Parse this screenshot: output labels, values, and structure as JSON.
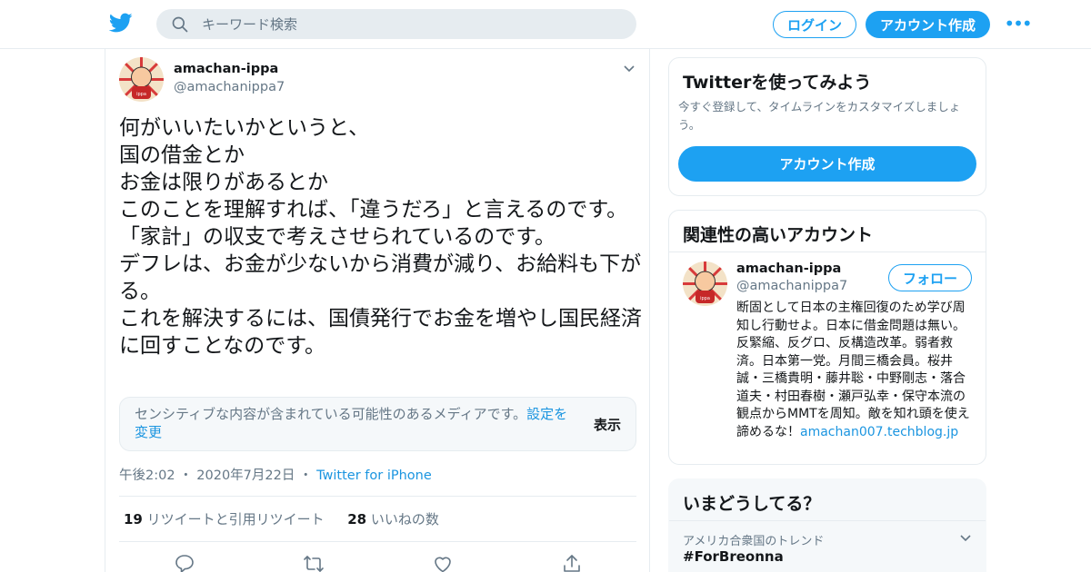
{
  "header": {
    "search_placeholder": "キーワード検索",
    "login_label": "ログイン",
    "signup_label": "アカウント作成",
    "more_label": "•••"
  },
  "tweet": {
    "author_name": "amachan-ippa",
    "author_handle": "@amachanippa7",
    "text": "何がいいたいかというと、\n国の借金とか\nお金は限りがあるとか\nこのことを理解すれば、「違うだろ」と言えるのです。\n「家計」の収支で考えさせられているのです。\nデフレは、お金が少ないから消費が減り、お給料も下がる。\nこれを解決するには、国債発行でお金を増やし国民経済に回すことなのです。",
    "sensitive_notice": "センシティブな内容が含まれている可能性のあるメディアです。",
    "sensitive_settings_link": "設定を変更",
    "sensitive_show": "表示",
    "time": "午後2:02",
    "date": "2020年7月22日",
    "source": "Twitter for iPhone",
    "retweet_count": "19",
    "retweet_label": "リツイートと引用リツイート",
    "like_count": "28",
    "like_label": "いいねの数"
  },
  "sidebar": {
    "try_card": {
      "title": "Twitterを使ってみよう",
      "description": "今すぐ登録して、タイムラインをカスタマイズしましょう。",
      "signup_label": "アカウント作成"
    },
    "related": {
      "title": "関連性の高いアカウント",
      "account_name": "amachan-ippa",
      "account_handle": "@amachanippa7",
      "follow_label": "フォロー",
      "bio": "断固として日本の主権回復のため学び周知し行動せよ。日本に借金問題は無い。反緊縮、反グロ、反構造改革。弱者救済。日本第一党。月間三橋会員。桜井誠・三橋貴明・藤井聡・中野剛志・落合道夫・村田春樹・瀬戸弘幸・保守本流の観点からMMTを周知。敵を知れ頭を使え諦めるな！",
      "bio_link": "amachan007.techblog.jp"
    },
    "trends": {
      "title": "いまどうしてる？",
      "location_label": "アメリカ合衆国のトレンド",
      "trend_tag": "#ForBreonna"
    }
  },
  "colors": {
    "brand": "#1da1f2",
    "link": "#1b95e0",
    "muted": "#657786",
    "border": "#e6ecf0"
  },
  "icons": [
    "twitter-bird-icon",
    "search-icon",
    "chevron-down-icon",
    "reply-icon",
    "retweet-icon",
    "like-icon",
    "share-icon"
  ]
}
